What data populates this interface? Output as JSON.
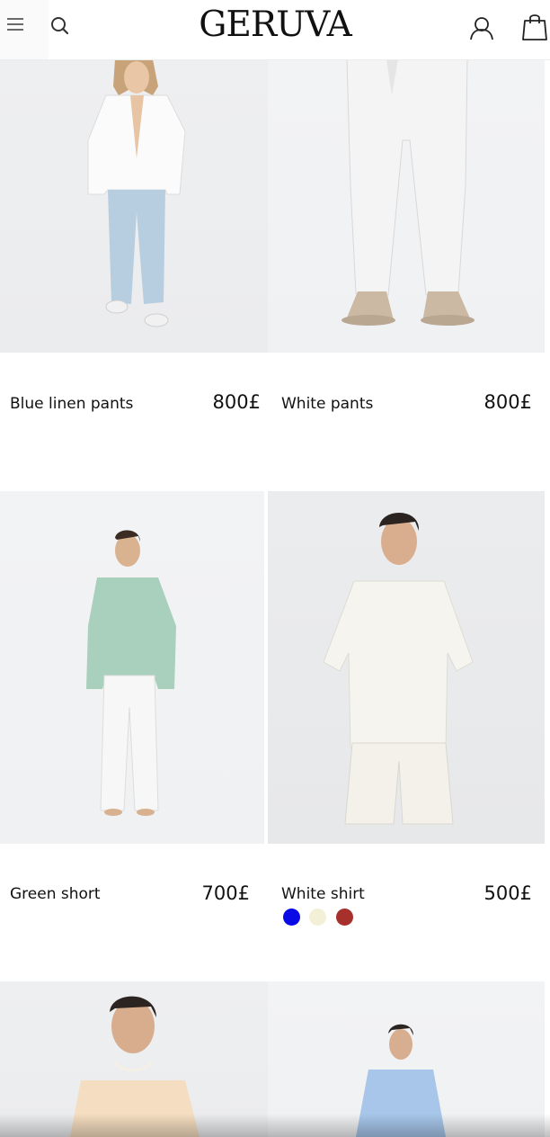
{
  "header": {
    "brand": "GERUVA",
    "menu_icon": "hamburger-menu-icon",
    "search_icon": "search-icon",
    "account_icon": "user-account-icon",
    "cart_icon": "shopping-bag-icon"
  },
  "products": [
    {
      "name": "Blue linen pants",
      "price": "800£"
    },
    {
      "name": "White pants",
      "price": "800£"
    },
    {
      "name": "Green short",
      "price": "700£"
    },
    {
      "name": "White shirt",
      "price": "500£",
      "swatches": [
        "#0a0ae6",
        "#f3f0d8",
        "#a8302c"
      ]
    },
    {
      "name": "",
      "price": ""
    },
    {
      "name": "",
      "price": ""
    }
  ]
}
